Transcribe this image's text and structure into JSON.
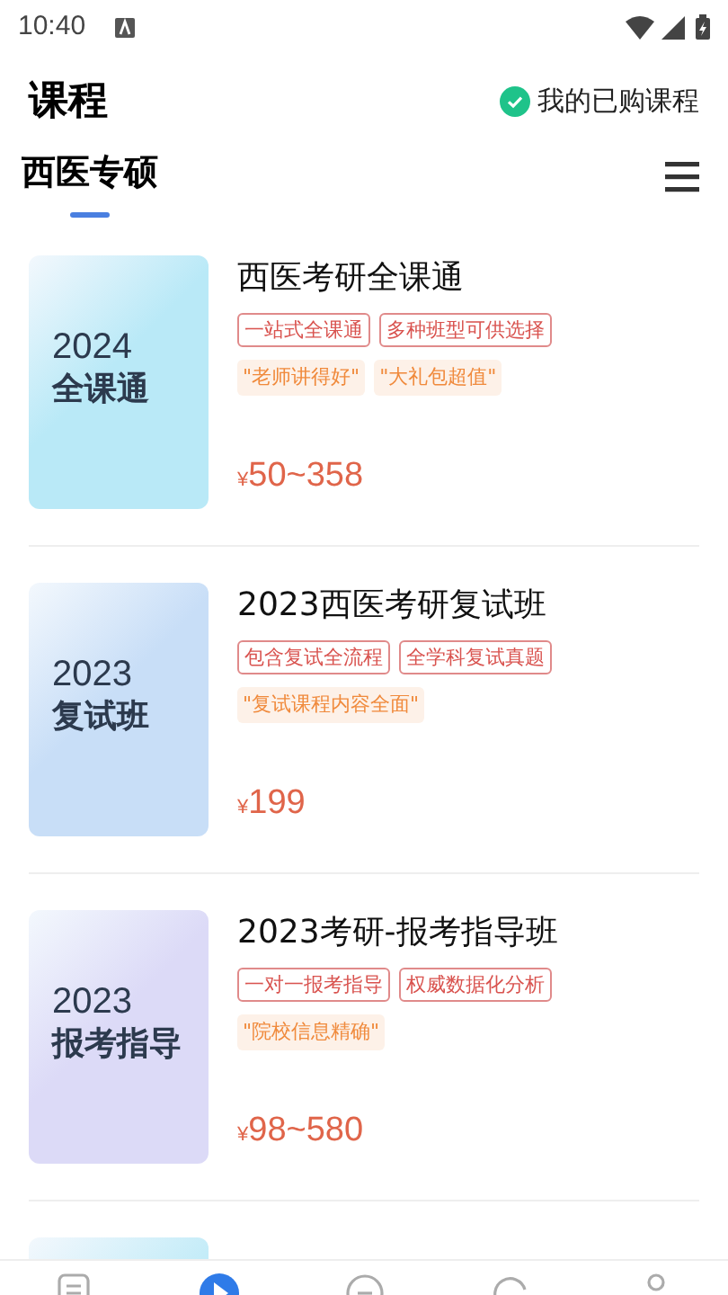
{
  "status_bar": {
    "time": "10:40"
  },
  "header": {
    "title": "课程",
    "purchased_link": "我的已购课程"
  },
  "tabs": [
    {
      "label": "西医专硕",
      "selected": true
    }
  ],
  "courses": [
    {
      "cover_year": "2024",
      "cover_name": "全课通",
      "color": "#b9e9f7",
      "title": "西医考研全课通",
      "tags": [
        "一站式全课通",
        "多种班型可供选择"
      ],
      "quotes": [
        "\"老师讲得好\"",
        "\"大礼包超值\""
      ],
      "currency": "¥",
      "price": "50~358"
    },
    {
      "cover_year": "2023",
      "cover_name": "复试班",
      "color": "#c8def7",
      "title": "2023西医考研复试班",
      "tags": [
        "包含复试全流程",
        "全学科复试真题"
      ],
      "quotes": [
        "\"复试课程内容全面\""
      ],
      "currency": "¥",
      "price": "199"
    },
    {
      "cover_year": "2023",
      "cover_name": "报考指导",
      "color": "#dcdaf7",
      "title": "2023考研-报考指导班",
      "tags": [
        "一对一报考指导",
        "权威数据化分析"
      ],
      "quotes": [
        "\"院校信息精确\""
      ],
      "currency": "¥",
      "price": "98~580"
    },
    {
      "color": "#c4ecf8"
    }
  ],
  "bottom_nav": [
    {
      "kind": "list",
      "selected": false
    },
    {
      "kind": "play",
      "selected": true
    },
    {
      "kind": "chat",
      "selected": false
    },
    {
      "kind": "refresh",
      "selected": false
    },
    {
      "kind": "person",
      "selected": false
    }
  ]
}
